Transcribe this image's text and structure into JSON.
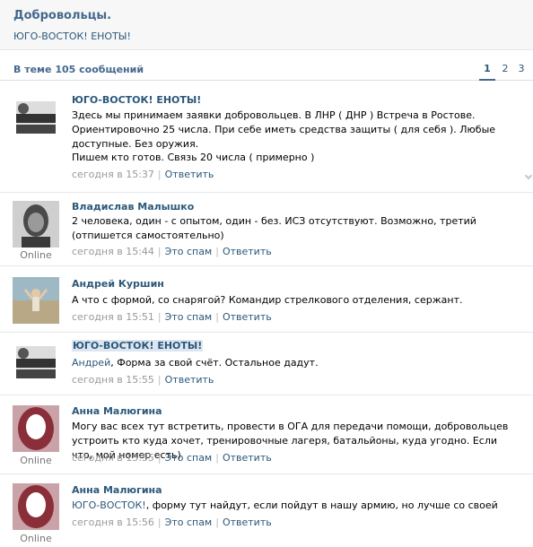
{
  "topic": {
    "title": "Добровольцы.",
    "subtitle": "ЮГО-ВОСТОК! ЕНОТЫ!"
  },
  "bar": {
    "count_text": "В теме 105 сообщений",
    "pages": [
      "1",
      "2",
      "3"
    ]
  },
  "posts": [
    {
      "author": "ЮГО-ВОСТОК! ЕНОТЫ!",
      "avatar_icon": "group-logo-icon",
      "text1": "Здесь мы принимаем заявки добровольцев. В ЛНР ( ДНР ) Встреча в Ростове. Ориентировочно 25 числа. При себе иметь средства защиты ( для себя ). Любые доступные. Без оружия.",
      "text2": "Пишем кто готов. Связь 20 числа ( примерно )",
      "time": "сегодня в 15:37",
      "reply": "Ответить"
    },
    {
      "author": "Владислав Малышко",
      "online": "Online",
      "text": "2 человека, один - с опытом, один - без. ИСЗ отсутствуют. Возможно, третий (отпишется самостоятельно)",
      "time": "сегодня в 15:44",
      "spam": "Это спам",
      "reply": "Ответить"
    },
    {
      "author": "Андрей Куршин",
      "text": "А что с формой, со снарягой? Командир стрелкового отделения, сержант.",
      "time": "сегодня в 15:51",
      "spam": "Это спам",
      "reply": "Ответить"
    },
    {
      "author": "ЮГО-ВОСТОК! ЕНОТЫ!",
      "mention": "Андрей",
      "text": ", Форма за свой счёт. Остальное дадут.",
      "time": "сегодня в 15:55",
      "reply": "Ответить"
    },
    {
      "author": "Анна Малюгина",
      "online": "Online",
      "text": "Могу вас всех тут встретить, провести в ОГА для передачи помощи, добровольцев устроить кто куда хочет, тренировочные лагеря, батальйоны, куда угодно. Если что, мой номер есть)",
      "time": "сегодня в 15:55",
      "spam": "Это спам",
      "reply": "Ответить"
    },
    {
      "author": "Анна Малюгина",
      "online": "Online",
      "mention": "ЮГО-ВОСТОК!",
      "text": ", форму тут найдут, если пойдут в нашу армию, но лучше со своей",
      "time": "сегодня в 15:56",
      "spam": "Это спам",
      "reply": "Ответить"
    }
  ],
  "colors": {
    "link": "#2b587a",
    "header_bg": "#f7f7f7",
    "meta": "#999999"
  }
}
